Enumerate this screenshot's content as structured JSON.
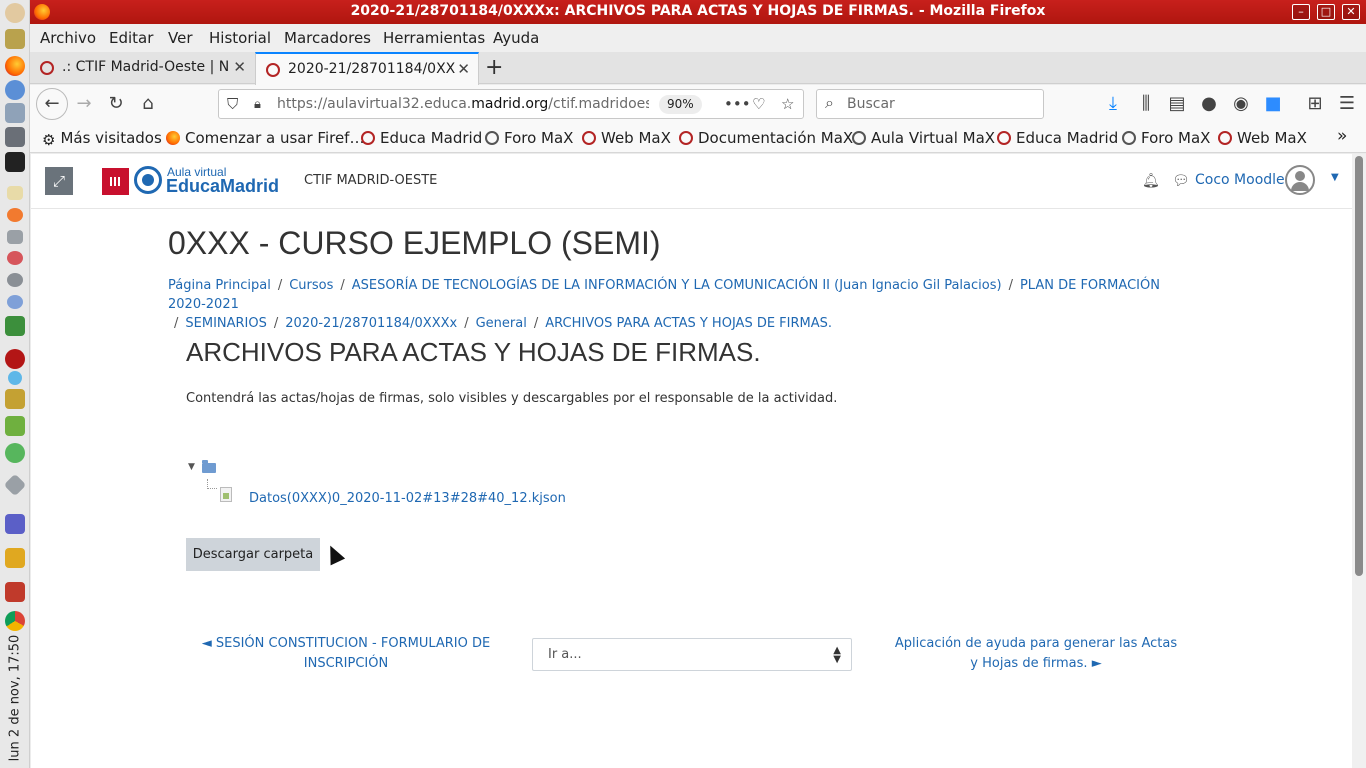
{
  "window": {
    "title": "2020-21/28701184/0XXXx: ARCHIVOS PARA ACTAS Y HOJAS DE FIRMAS. - Mozilla Firefox"
  },
  "desktop": {
    "clock": "lun 2 de nov, 17:50"
  },
  "menubar": [
    "Archivo",
    "Editar",
    "Ver",
    "Historial",
    "Marcadores",
    "Herramientas",
    "Ayuda"
  ],
  "tabs": [
    {
      "label": ".: CTIF Madrid-Oeste | N",
      "active": false
    },
    {
      "label": "2020-21/28701184/0XX",
      "active": true
    }
  ],
  "navbar": {
    "url_prefix": "https://aulavirtual32.educa.",
    "url_domain": "madrid.org",
    "url_suffix": "/ctif.madridoest",
    "zoom": "90%",
    "search_placeholder": "Buscar"
  },
  "bookmarks": [
    {
      "label": "Más visitados",
      "icon": "gear-icon"
    },
    {
      "label": "Comenzar a usar Firef…",
      "icon": "firefox-icon"
    },
    {
      "label": "Educa Madrid",
      "icon": "educamadrid-icon"
    },
    {
      "label": "Foro MaX",
      "icon": "globe-icon"
    },
    {
      "label": "Web MaX",
      "icon": "max-icon"
    },
    {
      "label": "Documentación MaX",
      "icon": "max-icon"
    },
    {
      "label": "Aula Virtual MaX",
      "icon": "globe-icon"
    },
    {
      "label": "Educa Madrid",
      "icon": "educamadrid-icon"
    },
    {
      "label": "Foro MaX",
      "icon": "globe-icon"
    },
    {
      "label": "Web MaX",
      "icon": "max-icon"
    }
  ],
  "header": {
    "logo_small": "Aula virtual",
    "logo_big": "EducaMadrid",
    "site_name": "CTIF MADRID-OESTE",
    "user_name": "Coco Moodler"
  },
  "course_title": "0XXX - CURSO EJEMPLO (SEMI)",
  "breadcrumb": [
    "Página Principal",
    "Cursos",
    "ASESORÍA DE TECNOLOGÍAS DE LA INFORMACIÓN Y LA COMUNICACIÓN II (Juan Ignacio Gil Palacios)",
    "PLAN DE FORMACIÓN 2020-2021",
    "SEMINARIOS",
    "2020-21/28701184/0XXXx",
    "General",
    "ARCHIVOS PARA ACTAS Y HOJAS DE FIRMAS."
  ],
  "activity": {
    "title": "ARCHIVOS PARA ACTAS Y HOJAS DE FIRMAS.",
    "description": "Contendrá las actas/hojas de firmas, solo visibles y descargables por el responsable de la actividad.",
    "file_name": "Datos(0XXX)0_2020-11-02#13#28#40_12.kjson",
    "download_label": "Descargar carpeta"
  },
  "navigation": {
    "prev_label": "◄ SESIÓN CONSTITUCION - FORMULARIO DE INSCRIPCIÓN",
    "jump_label": "Ir a...",
    "next_label": "Aplicación de ayuda para generar las Actas y Hojas de firmas. ►"
  },
  "colors": {
    "titlebar": "#c8201c",
    "link": "#1f68b2",
    "tab_accent": "#0a84ff"
  }
}
